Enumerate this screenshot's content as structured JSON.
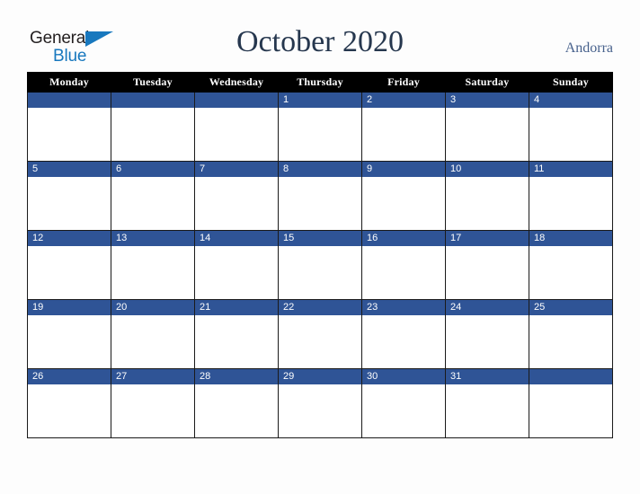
{
  "logo": {
    "text_primary": "General",
    "text_secondary": "Blue",
    "triangle_color": "#1878be"
  },
  "header": {
    "title": "October 2020",
    "region": "Andorra",
    "title_color": "#26374e",
    "region_color": "#47618c"
  },
  "calendar": {
    "weekday_headers": [
      "Monday",
      "Tuesday",
      "Wednesday",
      "Thursday",
      "Friday",
      "Saturday",
      "Sunday"
    ],
    "header_background": "#000000",
    "header_text_color": "#ffffff",
    "date_band_color": "#2f5496",
    "date_text_color": "#ffffff",
    "cell_background": "#ffffff",
    "border_color": "#1a1a1a",
    "weeks": [
      [
        {
          "date": ""
        },
        {
          "date": ""
        },
        {
          "date": ""
        },
        {
          "date": "1"
        },
        {
          "date": "2"
        },
        {
          "date": "3"
        },
        {
          "date": "4"
        }
      ],
      [
        {
          "date": "5"
        },
        {
          "date": "6"
        },
        {
          "date": "7"
        },
        {
          "date": "8"
        },
        {
          "date": "9"
        },
        {
          "date": "10"
        },
        {
          "date": "11"
        }
      ],
      [
        {
          "date": "12"
        },
        {
          "date": "13"
        },
        {
          "date": "14"
        },
        {
          "date": "15"
        },
        {
          "date": "16"
        },
        {
          "date": "17"
        },
        {
          "date": "18"
        }
      ],
      [
        {
          "date": "19"
        },
        {
          "date": "20"
        },
        {
          "date": "21"
        },
        {
          "date": "22"
        },
        {
          "date": "23"
        },
        {
          "date": "24"
        },
        {
          "date": "25"
        }
      ],
      [
        {
          "date": "26"
        },
        {
          "date": "27"
        },
        {
          "date": "28"
        },
        {
          "date": "29"
        },
        {
          "date": "30"
        },
        {
          "date": "31"
        },
        {
          "date": ""
        }
      ]
    ]
  }
}
